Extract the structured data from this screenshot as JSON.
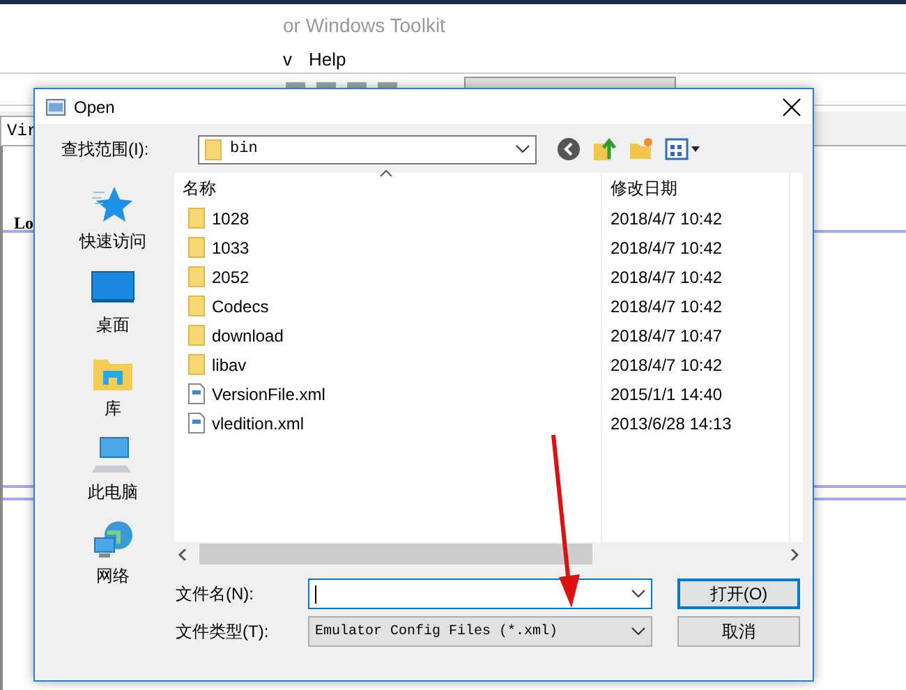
{
  "app": {
    "title": "or Windows Toolkit",
    "menu": [
      "v",
      "Help"
    ],
    "tab": "Vir",
    "content_label": "Lo"
  },
  "dialog": {
    "title": "Open",
    "look_in_label": "查找范围(I):",
    "look_in": "bin",
    "places": [
      {
        "label": "快速访问",
        "kind": "star"
      },
      {
        "label": "桌面",
        "kind": "desktop"
      },
      {
        "label": "库",
        "kind": "library"
      },
      {
        "label": "此电脑",
        "kind": "computer"
      },
      {
        "label": "网络",
        "kind": "network"
      }
    ],
    "columns": [
      "名称",
      "修改日期"
    ],
    "files": [
      {
        "name": "1028",
        "date": "2018/4/7 10:42",
        "kind": "folder"
      },
      {
        "name": "1033",
        "date": "2018/4/7 10:42",
        "kind": "folder"
      },
      {
        "name": "2052",
        "date": "2018/4/7 10:42",
        "kind": "folder"
      },
      {
        "name": "Codecs",
        "date": "2018/4/7 10:42",
        "kind": "folder"
      },
      {
        "name": "download",
        "date": "2018/4/7 10:47",
        "kind": "folder"
      },
      {
        "name": "libav",
        "date": "2018/4/7 10:42",
        "kind": "folder"
      },
      {
        "name": "VersionFile.xml",
        "date": "2015/1/1 14:40",
        "kind": "xml"
      },
      {
        "name": "vledition.xml",
        "date": "2013/6/28 14:13",
        "kind": "xml"
      }
    ],
    "file_name_label": "文件名(N):",
    "file_type_label": "文件类型(T):",
    "file_type": "Emulator Config Files (*.xml)",
    "buttons": [
      {
        "label": "打开(O)",
        "default": true
      },
      {
        "label": "取消",
        "default": false
      }
    ]
  }
}
